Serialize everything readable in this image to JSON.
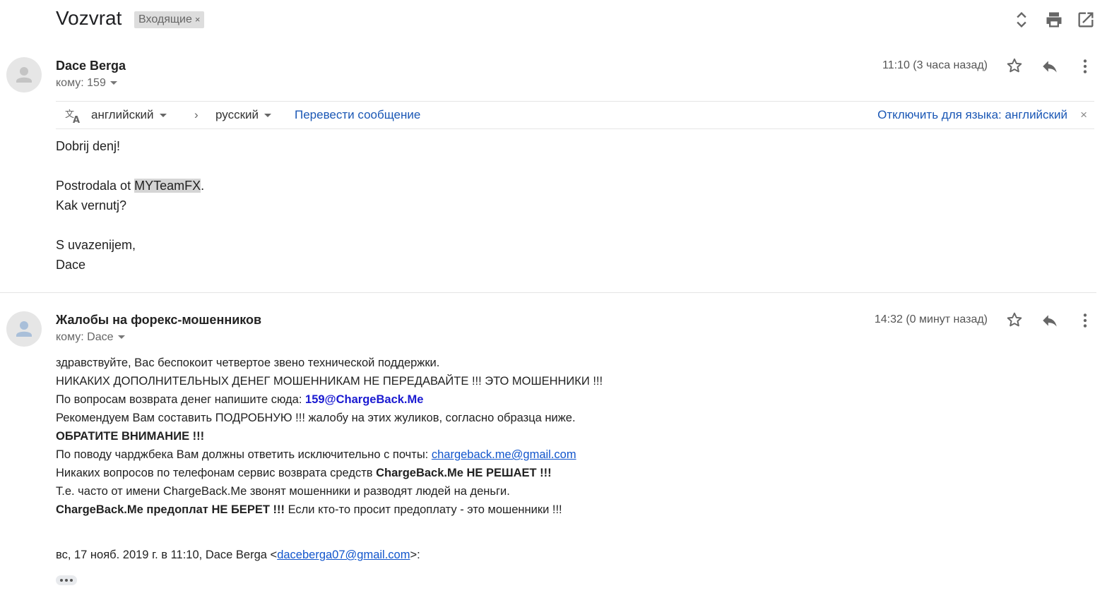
{
  "header": {
    "subject": "Vozvrat",
    "label": "Входящие",
    "label_close": "×"
  },
  "messages": [
    {
      "sender": "Dace Berga",
      "to_prefix": "кому:",
      "to": "159",
      "time": "11:10 (3 часа назад)",
      "translate_bar": {
        "source_lang": "английский",
        "arrow": "›",
        "target_lang": "русский",
        "translate_link": "Перевести сообщение",
        "disable_link": "Отключить для языка: английский",
        "close": "×"
      },
      "body": {
        "greeting": "Dobrij denj!",
        "line2_prefix": "Postrodala ot ",
        "line2_highlight": "MYTeamFX",
        "line2_suffix": ".",
        "line3": "Kak vernutj?",
        "signoff": "S uvazenijem,",
        "signature": "Dace"
      }
    },
    {
      "sender": "Жалобы на форекс-мошенников",
      "to_prefix": "кому:",
      "to": "Dace",
      "time": "14:32 (0 минут назад)",
      "body": {
        "l1": "здравствуйте, Вас беспокоит четвертое звено технической поддержки.",
        "l2": "НИКАКИХ ДОПОЛНИТЕЛЬНЫХ ДЕНЕГ МОШЕННИКАМ НЕ ПЕРЕДАВАЙТЕ !!! ЭТО МОШЕННИКИ !!!",
        "l3_prefix": "По вопросам возврата денег напишите сюда: ",
        "l3_email": "159@ChargeBack.Me",
        "l4": "Рекомендуем Вам составить ПОДРОБНУЮ !!! жалобу на этих жуликов, согласно образца ниже.",
        "l5": "ОБРАТИТЕ ВНИМАНИЕ !!!",
        "l6_prefix": "По поводу чарджбека Вам должны ответить исключительно с почты: ",
        "l6_email": "chargeback.me@gmail.com",
        "l7_prefix": "Никаких вопросов по телефонам сервис возврата средств ",
        "l7_bold": "ChargeBack.Me НЕ РЕШАЕТ !!!",
        "l8": "Т.е. часто от имени ChargeBack.Me звонят мошенники и разводят людей на деньги.",
        "l9_bold": "ChargeBack.Me предоплат НЕ БЕРЕТ !!!",
        "l9_suffix": " Если кто-то просит предоплату - это мошенники !!!",
        "quote_prefix": "вс, 17 нояб. 2019 г. в 11:10, Dace Berga <",
        "quote_email": "daceberga07@gmail.com",
        "quote_suffix": ">:"
      }
    }
  ],
  "icons": {
    "top": [
      "expand-collapse-icon",
      "print-icon",
      "open-in-new-window-icon"
    ],
    "message_actions": [
      "star-icon",
      "reply-icon",
      "more-vert-icon"
    ]
  }
}
